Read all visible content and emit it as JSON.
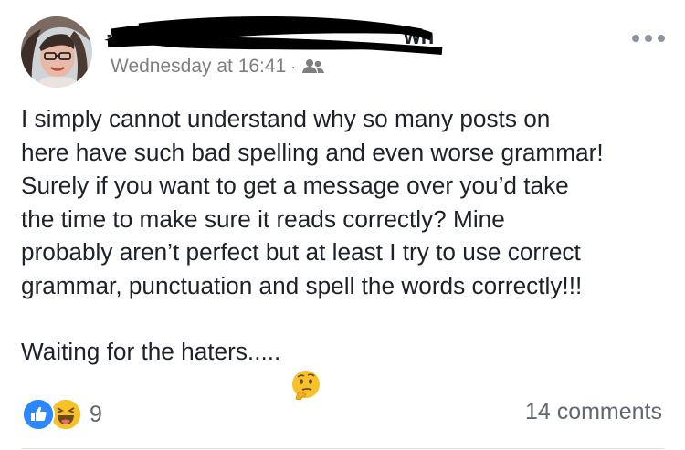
{
  "post": {
    "timestamp": "Wednesday at 16:41",
    "separator": "·",
    "privacy_icon": "friends-icon",
    "paragraph_1": "I simply cannot understand why so many posts on\nhere have such bad spelling and even worse grammar!\nSurely if you want to get a message over you’d take\nthe time to make sure it reads correctly?  Mine\nprobably aren’t perfect but at least I try to use correct\ngrammar, punctuation and spell the words correctly!!!",
    "paragraph_2": "Waiting for the haters.....",
    "emoji": "thinking-face-icon"
  },
  "footer": {
    "reaction_icons": [
      "like-icon",
      "haha-icon"
    ],
    "reaction_count": "9",
    "comments": "14 comments"
  },
  "colors": {
    "text": "#1d2129",
    "meta": "#7f7f7f",
    "like_blue": "#2d88ff",
    "haha_yellow": "#f7c12a"
  }
}
